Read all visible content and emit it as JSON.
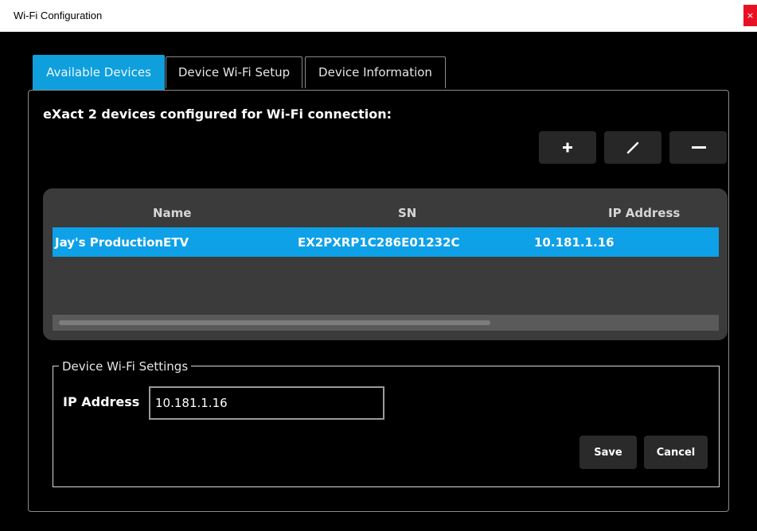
{
  "window": {
    "title": "Wi-Fi Configuration",
    "close_glyph": "×"
  },
  "tabs": [
    {
      "label": "Available Devices",
      "active": true
    },
    {
      "label": "Device Wi-Fi Setup",
      "active": false
    },
    {
      "label": "Device Information",
      "active": false
    }
  ],
  "panel": {
    "heading": "eXact 2 devices configured for Wi-Fi connection:",
    "toolbar": {
      "add_icon": "plus-icon",
      "edit_icon": "pencil-icon",
      "remove_icon": "minus-icon"
    }
  },
  "table": {
    "columns": [
      "Name",
      "SN",
      "IP Address"
    ],
    "rows": [
      {
        "name": "Jay's ProductionETV",
        "sn": "EX2PXRP1C286E01232C",
        "ip": "10.181.1.16",
        "selected": true
      }
    ]
  },
  "settings": {
    "legend": "Device Wi-Fi Settings",
    "ip_label": "IP Address",
    "ip_value": "10.181.1.16",
    "save_label": "Save",
    "cancel_label": "Cancel"
  },
  "colors": {
    "accent": "#0e9fdc",
    "selection": "#0ea1e8",
    "close": "#e81123",
    "background": "#000000"
  }
}
